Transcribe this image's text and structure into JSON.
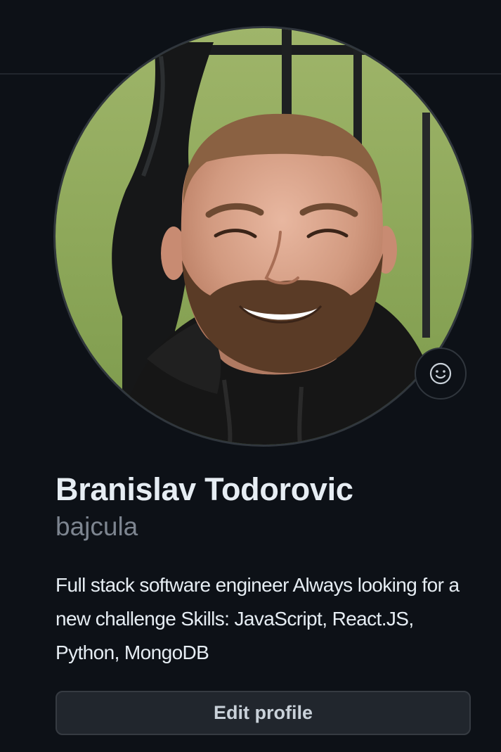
{
  "profile": {
    "name": "Branislav Todorovic",
    "login": "bajcula",
    "bio": "Full stack software engineer Always looking for a new challenge Skills: JavaScript, React.JS, Python, MongoDB",
    "edit_profile_label": "Edit profile"
  },
  "icons": {
    "status": "smiley-icon",
    "avatar": "profile-photo"
  },
  "colors": {
    "background": "#0d1117",
    "name_text": "#e6edf3",
    "login_text": "#7d8590",
    "button_bg": "#21262d",
    "border": "#30363d"
  }
}
